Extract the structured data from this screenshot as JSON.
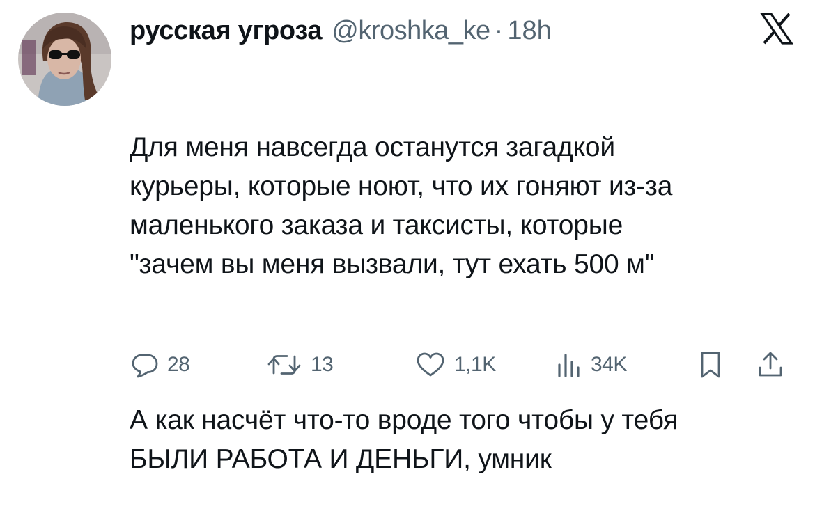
{
  "tweet": {
    "author": {
      "display_name": "русская угроза",
      "handle": "@kroshka_ke",
      "separator": "·",
      "time": "18h"
    },
    "paragraphs": [
      "Для меня навсегда останутся загадкой\nкурьеры, которые ноют, что их гоняют из-за\nмаленького заказа и таксисты, которые\n\"зачем вы меня вызвали, тут ехать 500 м\"",
      "А как насчёт что-то вроде того чтобы у тебя\nБЫЛИ РАБОТА И ДЕНЬГИ, умник"
    ],
    "stats": {
      "replies": "28",
      "reposts": "13",
      "likes": "1,1K",
      "views": "34K"
    }
  },
  "icons": {
    "brand": "x-logo-icon",
    "reply": "speech-bubble-icon",
    "repost": "repost-arrows-icon",
    "like": "heart-icon",
    "views": "bar-chart-icon",
    "bookmark": "bookmark-icon",
    "share": "share-upload-icon"
  },
  "colors": {
    "text": "#0f1419",
    "secondary": "#536471",
    "background": "#ffffff"
  }
}
